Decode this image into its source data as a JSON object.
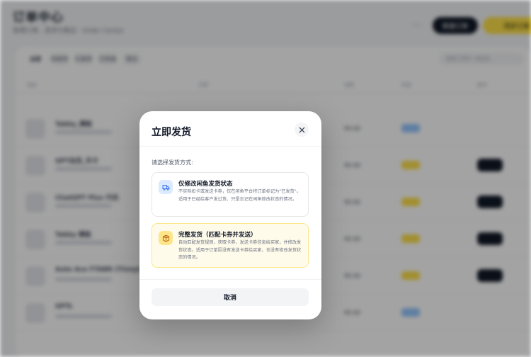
{
  "background": {
    "title": "订单中心",
    "subtitle": "管理订单、发货与售后 · Order Center",
    "more_icon": "more-icon",
    "header_buttons": [
      "新建订单",
      "同步订单"
    ],
    "tabs": [
      "全部",
      "待发货",
      "已发货",
      "已完成",
      "售后"
    ],
    "search_placeholder": "搜索订单号 / 商品名",
    "columns": [
      "商品",
      "买家",
      "金额",
      "状态",
      "操作"
    ],
    "rows": [
      {
        "name": "Tabby_模板",
        "amount": "¥0.00",
        "status_color": "#93c5fd",
        "has_action": false
      },
      {
        "name": "GPT会员_月卡",
        "amount": "¥0.00",
        "status_color": "#fde047",
        "has_action": true
      },
      {
        "name": "ChatGPT Plus 代充",
        "amount": "¥0.00",
        "status_color": "#fde047",
        "has_action": true
      },
      {
        "name": "Tabby 模板",
        "amount": "¥0.00",
        "status_color": "#fde047",
        "has_action": true
      },
      {
        "name": "Auto Ace FTABR (Tinnyt...)",
        "amount": "¥0.00",
        "status_color": "#fde047",
        "has_action": true
      },
      {
        "name": "GPTs",
        "amount": "¥0.00",
        "status_color": "#93c5fd",
        "has_action": false
      }
    ]
  },
  "modal": {
    "title": "立即发货",
    "close_icon": "close-icon",
    "prompt": "请选择发货方式:",
    "options": [
      {
        "icon": "truck-icon",
        "title": "仅修改闲鱼发货状态",
        "description": "不实际扣卡或发送卡券，仅在闲鱼平台将订单标记为\"已发货\"。适用于已经给客户发过货、只是忘记在闲鱼修改状态的情况。"
      },
      {
        "icon": "package-icon",
        "title": "完整发货（匹配卡券并发送）",
        "description": "自动匹配发货规则，获取卡券、发送卡券信息给买家，并修改发货状态。适用于订单因没有发送卡券给买家，也没有修改发货状态的情况。"
      }
    ],
    "cancel_label": "取消"
  },
  "colors": {
    "accent_yellow": "#fde047",
    "option_blue_bg": "#dbeafe",
    "option_yellow_bg": "#fffbeb",
    "dark_button": "#111827"
  }
}
